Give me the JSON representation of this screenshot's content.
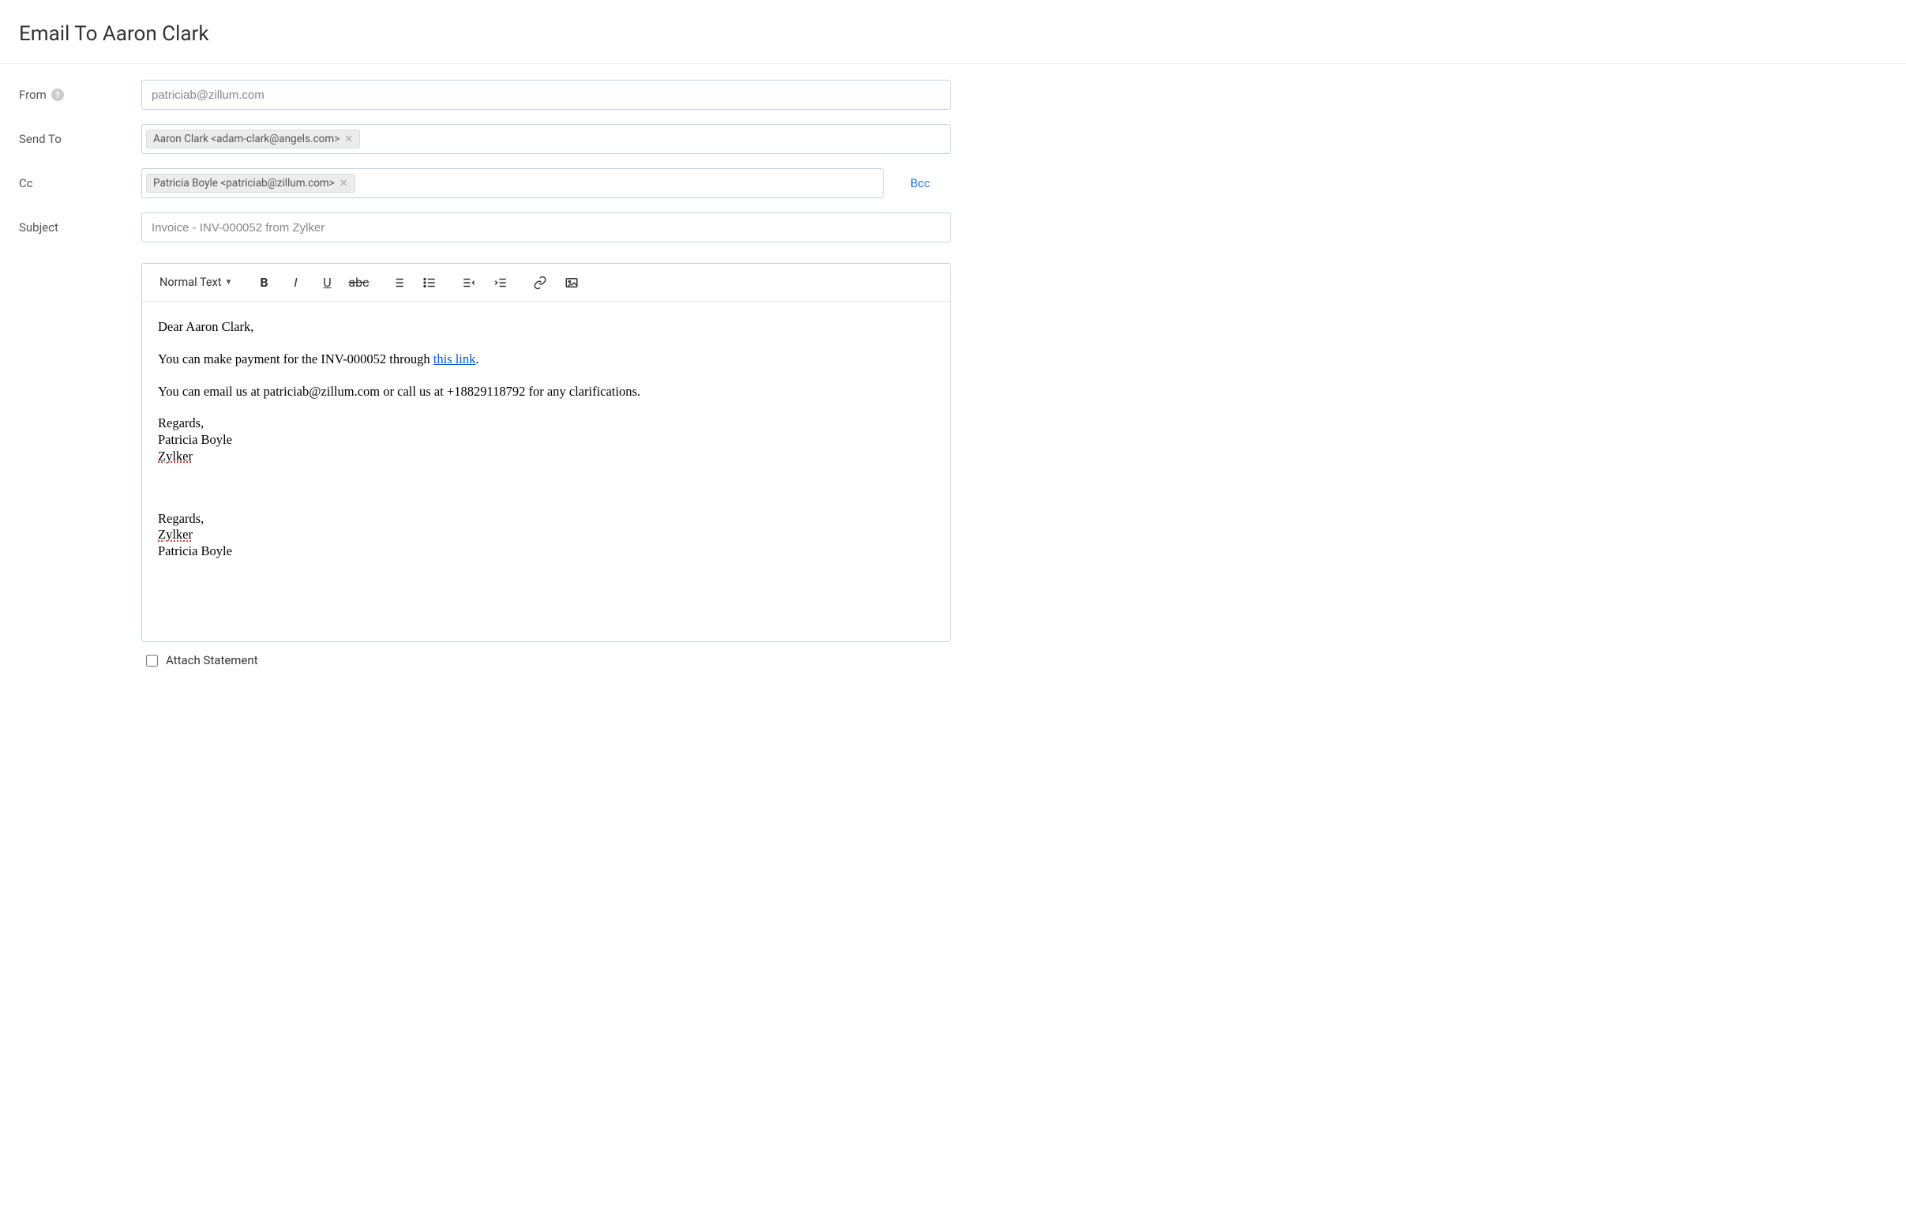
{
  "title": "Email To Aaron Clark",
  "fields": {
    "from_label": "From",
    "from_value": "patriciab@zillum.com",
    "sendto_label": "Send To",
    "sendto_chip": "Aaron Clark <adam-clark@angels.com>",
    "cc_label": "Cc",
    "cc_chip": "Patricia Boyle <patriciab@zillum.com>",
    "bcc_link": "Bcc",
    "subject_label": "Subject",
    "subject_value": "Invoice - INV-000052 from Zylker"
  },
  "toolbar": {
    "block_style": "Normal Text"
  },
  "body": {
    "greeting": "Dear Aaron Clark,",
    "p1_a": "You can make payment for the INV-000052 through ",
    "p1_link": "this link",
    "p1_b": ".",
    "p2": "You can email us at patriciab@zillum.com or call us at +18829118792 for any clarifications.",
    "sig1_a": "Regards,",
    "sig1_b": "Patricia Boyle",
    "sig1_c": "Zylker",
    "sig2_a": "Regards,",
    "sig2_b": "Zylker",
    "sig2_c": "Patricia Boyle"
  },
  "attach_label": "Attach Statement"
}
